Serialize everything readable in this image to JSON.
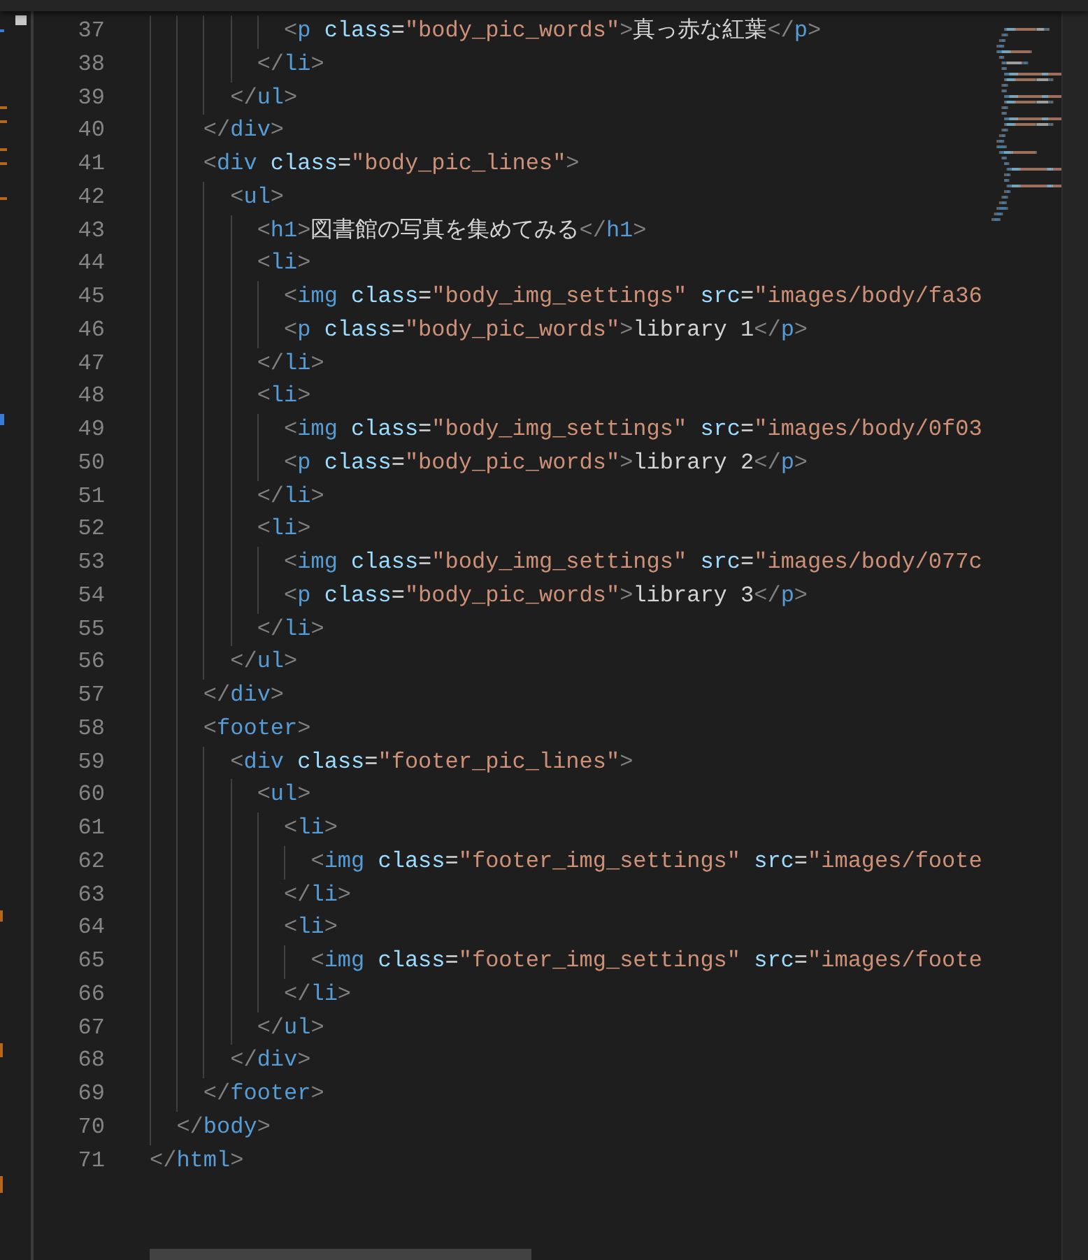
{
  "editor": {
    "lines": [
      {
        "number": "37",
        "tokens": [
          {
            "kind": "punct",
            "text": "          <"
          },
          {
            "kind": "tag",
            "text": "p"
          },
          {
            "kind": "attr",
            "text": " class"
          },
          {
            "kind": "text",
            "text": "="
          },
          {
            "kind": "string",
            "text": "\"body_pic_words\""
          },
          {
            "kind": "punct",
            "text": ">"
          },
          {
            "kind": "text",
            "text": "真っ赤な紅葉"
          },
          {
            "kind": "punct",
            "text": "</"
          },
          {
            "kind": "tag",
            "text": "p"
          },
          {
            "kind": "punct",
            "text": ">"
          }
        ]
      },
      {
        "number": "38",
        "tokens": [
          {
            "kind": "punct",
            "text": "        </"
          },
          {
            "kind": "tag",
            "text": "li"
          },
          {
            "kind": "punct",
            "text": ">"
          }
        ]
      },
      {
        "number": "39",
        "tokens": [
          {
            "kind": "punct",
            "text": "      </"
          },
          {
            "kind": "tag",
            "text": "ul"
          },
          {
            "kind": "punct",
            "text": ">"
          }
        ]
      },
      {
        "number": "40",
        "tokens": [
          {
            "kind": "punct",
            "text": "    </"
          },
          {
            "kind": "tag",
            "text": "div"
          },
          {
            "kind": "punct",
            "text": ">"
          }
        ]
      },
      {
        "number": "41",
        "tokens": [
          {
            "kind": "punct",
            "text": "    <"
          },
          {
            "kind": "tag",
            "text": "div"
          },
          {
            "kind": "attr",
            "text": " class"
          },
          {
            "kind": "text",
            "text": "="
          },
          {
            "kind": "string",
            "text": "\"body_pic_lines\""
          },
          {
            "kind": "punct",
            "text": ">"
          }
        ]
      },
      {
        "number": "42",
        "tokens": [
          {
            "kind": "punct",
            "text": "      <"
          },
          {
            "kind": "tag",
            "text": "ul"
          },
          {
            "kind": "punct",
            "text": ">"
          }
        ]
      },
      {
        "number": "43",
        "tokens": [
          {
            "kind": "punct",
            "text": "        <"
          },
          {
            "kind": "tag",
            "text": "h1"
          },
          {
            "kind": "punct",
            "text": ">"
          },
          {
            "kind": "text",
            "text": "図書館の写真を集めてみる"
          },
          {
            "kind": "punct",
            "text": "</"
          },
          {
            "kind": "tag",
            "text": "h1"
          },
          {
            "kind": "punct",
            "text": ">"
          }
        ]
      },
      {
        "number": "44",
        "tokens": [
          {
            "kind": "punct",
            "text": "        <"
          },
          {
            "kind": "tag",
            "text": "li"
          },
          {
            "kind": "punct",
            "text": ">"
          }
        ]
      },
      {
        "number": "45",
        "tokens": [
          {
            "kind": "punct",
            "text": "          <"
          },
          {
            "kind": "tag",
            "text": "img"
          },
          {
            "kind": "attr",
            "text": " class"
          },
          {
            "kind": "text",
            "text": "="
          },
          {
            "kind": "string",
            "text": "\"body_img_settings\""
          },
          {
            "kind": "attr",
            "text": " src"
          },
          {
            "kind": "text",
            "text": "="
          },
          {
            "kind": "string",
            "text": "\"images/body/fa36"
          }
        ]
      },
      {
        "number": "46",
        "tokens": [
          {
            "kind": "punct",
            "text": "          <"
          },
          {
            "kind": "tag",
            "text": "p"
          },
          {
            "kind": "attr",
            "text": " class"
          },
          {
            "kind": "text",
            "text": "="
          },
          {
            "kind": "string",
            "text": "\"body_pic_words\""
          },
          {
            "kind": "punct",
            "text": ">"
          },
          {
            "kind": "text",
            "text": "library 1"
          },
          {
            "kind": "punct",
            "text": "</"
          },
          {
            "kind": "tag",
            "text": "p"
          },
          {
            "kind": "punct",
            "text": ">"
          }
        ]
      },
      {
        "number": "47",
        "tokens": [
          {
            "kind": "punct",
            "text": "        </"
          },
          {
            "kind": "tag",
            "text": "li"
          },
          {
            "kind": "punct",
            "text": ">"
          }
        ]
      },
      {
        "number": "48",
        "tokens": [
          {
            "kind": "punct",
            "text": "        <"
          },
          {
            "kind": "tag",
            "text": "li"
          },
          {
            "kind": "punct",
            "text": ">"
          }
        ]
      },
      {
        "number": "49",
        "tokens": [
          {
            "kind": "punct",
            "text": "          <"
          },
          {
            "kind": "tag",
            "text": "img"
          },
          {
            "kind": "attr",
            "text": " class"
          },
          {
            "kind": "text",
            "text": "="
          },
          {
            "kind": "string",
            "text": "\"body_img_settings\""
          },
          {
            "kind": "attr",
            "text": " src"
          },
          {
            "kind": "text",
            "text": "="
          },
          {
            "kind": "string",
            "text": "\"images/body/0f03"
          }
        ]
      },
      {
        "number": "50",
        "tokens": [
          {
            "kind": "punct",
            "text": "          <"
          },
          {
            "kind": "tag",
            "text": "p"
          },
          {
            "kind": "attr",
            "text": " class"
          },
          {
            "kind": "text",
            "text": "="
          },
          {
            "kind": "string",
            "text": "\"body_pic_words\""
          },
          {
            "kind": "punct",
            "text": ">"
          },
          {
            "kind": "text",
            "text": "library 2"
          },
          {
            "kind": "punct",
            "text": "</"
          },
          {
            "kind": "tag",
            "text": "p"
          },
          {
            "kind": "punct",
            "text": ">"
          }
        ]
      },
      {
        "number": "51",
        "tokens": [
          {
            "kind": "punct",
            "text": "        </"
          },
          {
            "kind": "tag",
            "text": "li"
          },
          {
            "kind": "punct",
            "text": ">"
          }
        ]
      },
      {
        "number": "52",
        "tokens": [
          {
            "kind": "punct",
            "text": "        <"
          },
          {
            "kind": "tag",
            "text": "li"
          },
          {
            "kind": "punct",
            "text": ">"
          }
        ]
      },
      {
        "number": "53",
        "tokens": [
          {
            "kind": "punct",
            "text": "          <"
          },
          {
            "kind": "tag",
            "text": "img"
          },
          {
            "kind": "attr",
            "text": " class"
          },
          {
            "kind": "text",
            "text": "="
          },
          {
            "kind": "string",
            "text": "\"body_img_settings\""
          },
          {
            "kind": "attr",
            "text": " src"
          },
          {
            "kind": "text",
            "text": "="
          },
          {
            "kind": "string",
            "text": "\"images/body/077c"
          }
        ]
      },
      {
        "number": "54",
        "tokens": [
          {
            "kind": "punct",
            "text": "          <"
          },
          {
            "kind": "tag",
            "text": "p"
          },
          {
            "kind": "attr",
            "text": " class"
          },
          {
            "kind": "text",
            "text": "="
          },
          {
            "kind": "string",
            "text": "\"body_pic_words\""
          },
          {
            "kind": "punct",
            "text": ">"
          },
          {
            "kind": "text",
            "text": "library 3"
          },
          {
            "kind": "punct",
            "text": "</"
          },
          {
            "kind": "tag",
            "text": "p"
          },
          {
            "kind": "punct",
            "text": ">"
          }
        ]
      },
      {
        "number": "55",
        "tokens": [
          {
            "kind": "punct",
            "text": "        </"
          },
          {
            "kind": "tag",
            "text": "li"
          },
          {
            "kind": "punct",
            "text": ">"
          }
        ]
      },
      {
        "number": "56",
        "tokens": [
          {
            "kind": "punct",
            "text": "      </"
          },
          {
            "kind": "tag",
            "text": "ul"
          },
          {
            "kind": "punct",
            "text": ">"
          }
        ]
      },
      {
        "number": "57",
        "tokens": [
          {
            "kind": "punct",
            "text": "    </"
          },
          {
            "kind": "tag",
            "text": "div"
          },
          {
            "kind": "punct",
            "text": ">"
          }
        ]
      },
      {
        "number": "58",
        "tokens": [
          {
            "kind": "punct",
            "text": "    <"
          },
          {
            "kind": "tag",
            "text": "footer"
          },
          {
            "kind": "punct",
            "text": ">"
          }
        ]
      },
      {
        "number": "59",
        "tokens": [
          {
            "kind": "punct",
            "text": "      <"
          },
          {
            "kind": "tag",
            "text": "div"
          },
          {
            "kind": "attr",
            "text": " class"
          },
          {
            "kind": "text",
            "text": "="
          },
          {
            "kind": "string",
            "text": "\"footer_pic_lines\""
          },
          {
            "kind": "punct",
            "text": ">"
          }
        ]
      },
      {
        "number": "60",
        "tokens": [
          {
            "kind": "punct",
            "text": "        <"
          },
          {
            "kind": "tag",
            "text": "ul"
          },
          {
            "kind": "punct",
            "text": ">"
          }
        ]
      },
      {
        "number": "61",
        "tokens": [
          {
            "kind": "punct",
            "text": "          <"
          },
          {
            "kind": "tag",
            "text": "li"
          },
          {
            "kind": "punct",
            "text": ">"
          }
        ]
      },
      {
        "number": "62",
        "tokens": [
          {
            "kind": "punct",
            "text": "            <"
          },
          {
            "kind": "tag",
            "text": "img"
          },
          {
            "kind": "attr",
            "text": " class"
          },
          {
            "kind": "text",
            "text": "="
          },
          {
            "kind": "string",
            "text": "\"footer_img_settings\""
          },
          {
            "kind": "attr",
            "text": " src"
          },
          {
            "kind": "text",
            "text": "="
          },
          {
            "kind": "string",
            "text": "\"images/foote"
          }
        ]
      },
      {
        "number": "63",
        "tokens": [
          {
            "kind": "punct",
            "text": "          </"
          },
          {
            "kind": "tag",
            "text": "li"
          },
          {
            "kind": "punct",
            "text": ">"
          }
        ]
      },
      {
        "number": "64",
        "tokens": [
          {
            "kind": "punct",
            "text": "          <"
          },
          {
            "kind": "tag",
            "text": "li"
          },
          {
            "kind": "punct",
            "text": ">"
          }
        ]
      },
      {
        "number": "65",
        "tokens": [
          {
            "kind": "punct",
            "text": "            <"
          },
          {
            "kind": "tag",
            "text": "img"
          },
          {
            "kind": "attr",
            "text": " class"
          },
          {
            "kind": "text",
            "text": "="
          },
          {
            "kind": "string",
            "text": "\"footer_img_settings\""
          },
          {
            "kind": "attr",
            "text": " src"
          },
          {
            "kind": "text",
            "text": "="
          },
          {
            "kind": "string",
            "text": "\"images/foote"
          }
        ]
      },
      {
        "number": "66",
        "tokens": [
          {
            "kind": "punct",
            "text": "          </"
          },
          {
            "kind": "tag",
            "text": "li"
          },
          {
            "kind": "punct",
            "text": ">"
          }
        ]
      },
      {
        "number": "67",
        "tokens": [
          {
            "kind": "punct",
            "text": "        </"
          },
          {
            "kind": "tag",
            "text": "ul"
          },
          {
            "kind": "punct",
            "text": ">"
          }
        ]
      },
      {
        "number": "68",
        "tokens": [
          {
            "kind": "punct",
            "text": "      </"
          },
          {
            "kind": "tag",
            "text": "div"
          },
          {
            "kind": "punct",
            "text": ">"
          }
        ]
      },
      {
        "number": "69",
        "tokens": [
          {
            "kind": "punct",
            "text": "    </"
          },
          {
            "kind": "tag",
            "text": "footer"
          },
          {
            "kind": "punct",
            "text": ">"
          }
        ]
      },
      {
        "number": "70",
        "tokens": [
          {
            "kind": "punct",
            "text": "  </"
          },
          {
            "kind": "tag",
            "text": "body"
          },
          {
            "kind": "punct",
            "text": ">"
          }
        ]
      },
      {
        "number": "71",
        "tokens": [
          {
            "kind": "punct",
            "text": "</"
          },
          {
            "kind": "tag",
            "text": "html"
          },
          {
            "kind": "punct",
            "text": ">"
          }
        ]
      }
    ]
  }
}
